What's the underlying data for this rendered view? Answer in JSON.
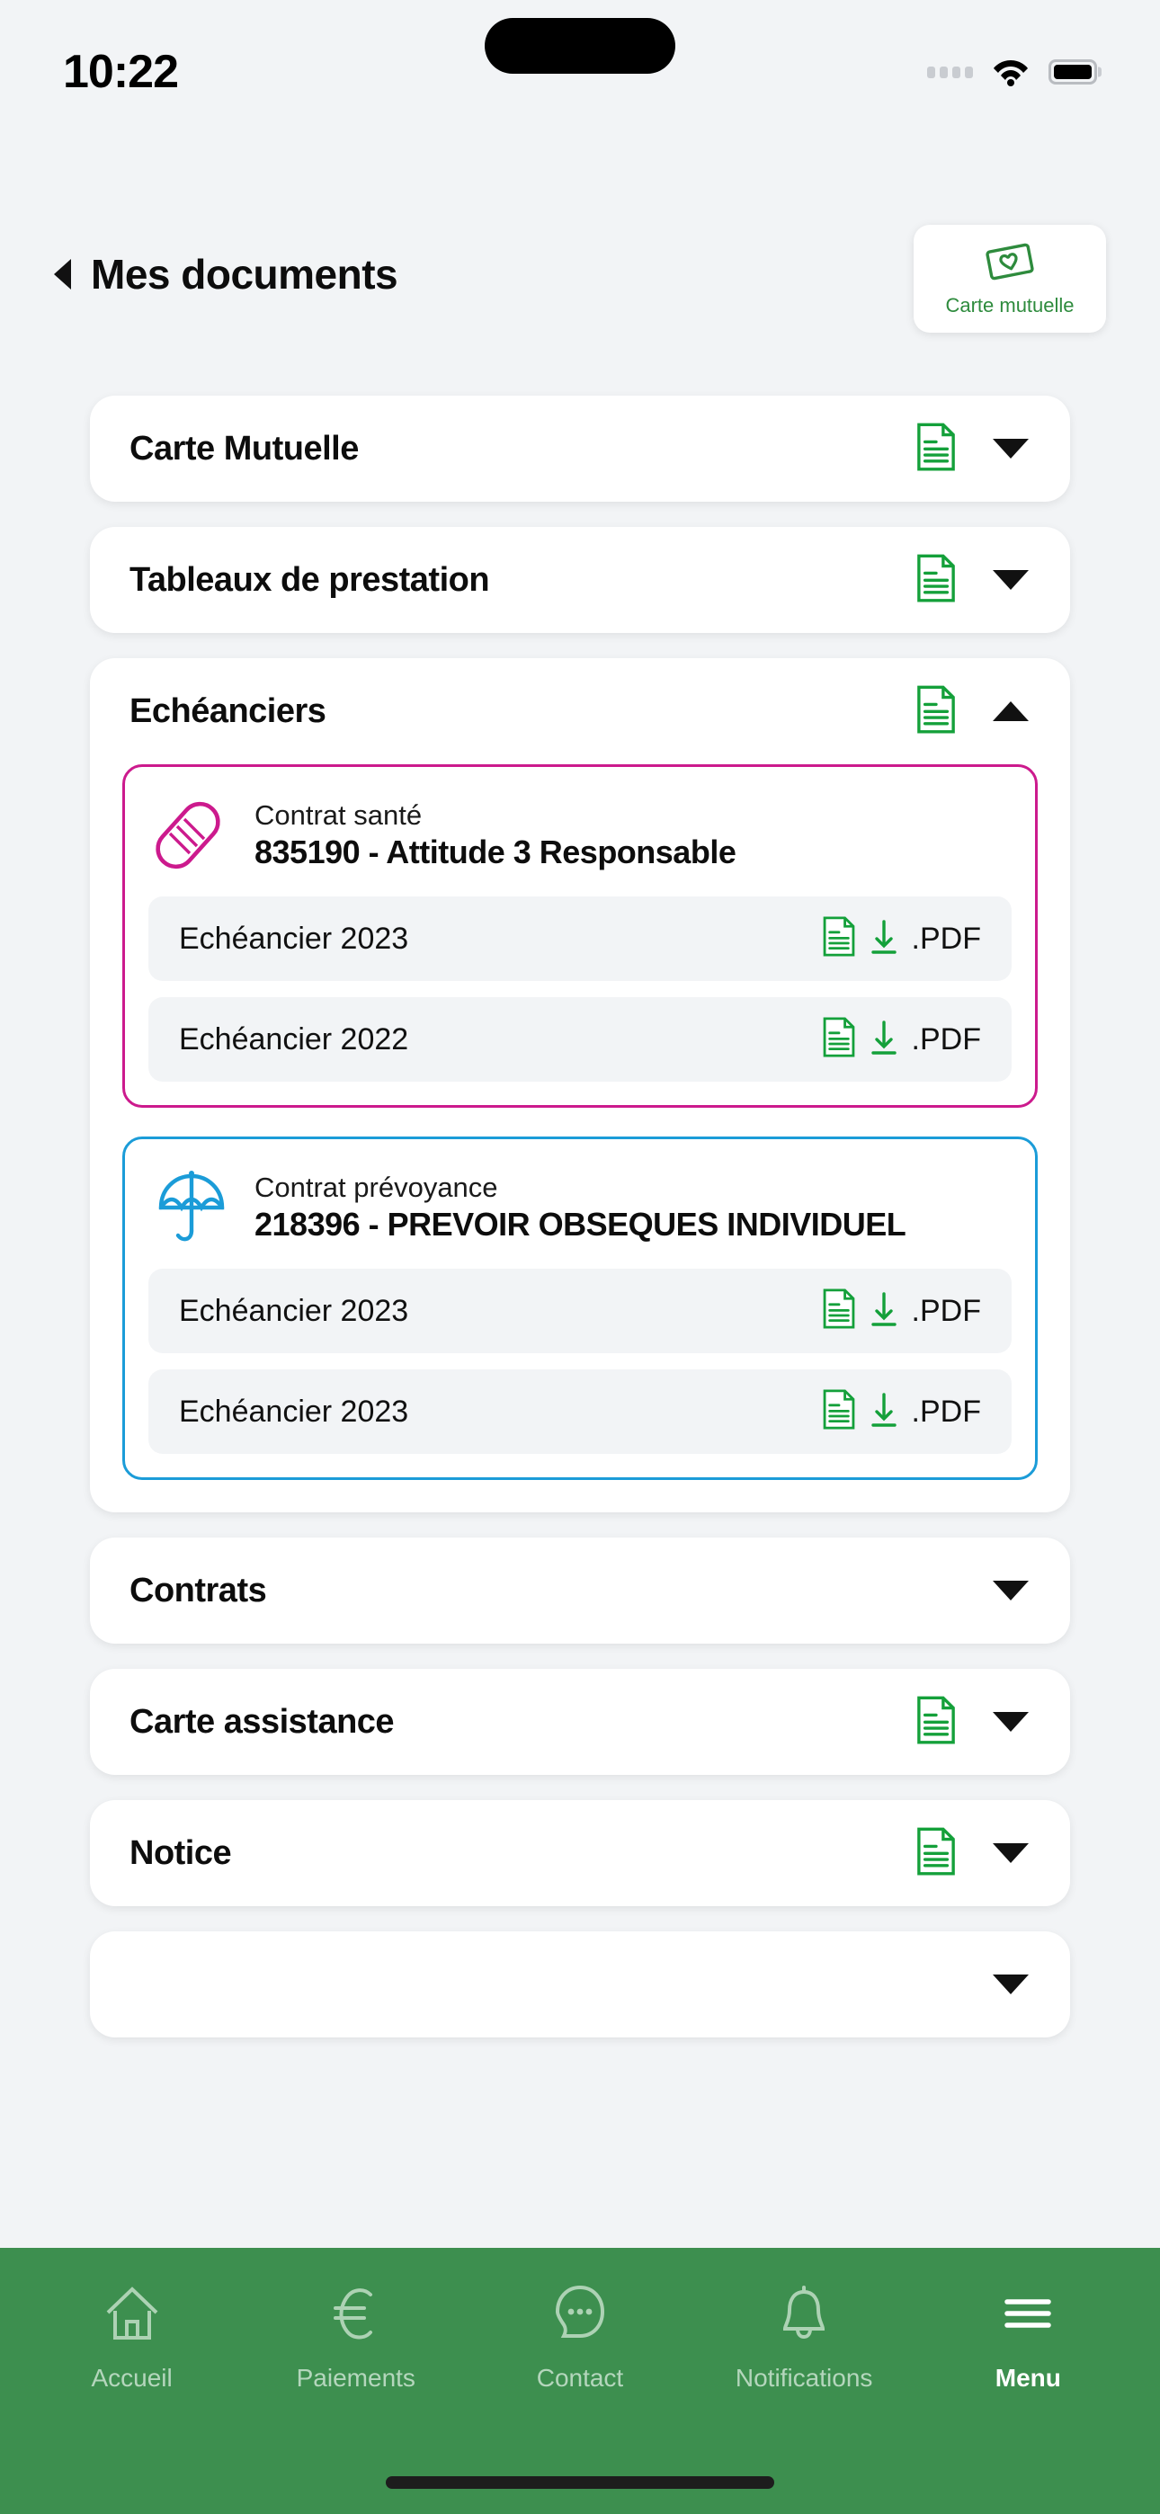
{
  "status_bar": {
    "time": "10:22",
    "signal_icon": "signal-dots-icon",
    "wifi_icon": "wifi-icon",
    "battery_icon": "battery-icon"
  },
  "header": {
    "back_icon": "back-arrow-icon",
    "title": "Mes documents",
    "action_button": {
      "icon": "mutual-card-heart-icon",
      "label": "Carte mutuelle"
    }
  },
  "colors": {
    "brand_green": "#3d8f4f",
    "doc_icon_green": "#14a03a",
    "health_magenta": "#cc1a8d",
    "prevoyance_blue": "#1b9cd8",
    "page_background": "#f2f4f6",
    "card_background": "#ffffff",
    "row_background": "#f2f4f6"
  },
  "sections": [
    {
      "title": "Carte Mutuelle",
      "has_doc_icon": true,
      "expanded": false,
      "chevron": "chevron-down-icon"
    },
    {
      "title": "Tableaux de prestation",
      "has_doc_icon": true,
      "expanded": false,
      "chevron": "chevron-down-icon"
    },
    {
      "title": "Echéanciers",
      "has_doc_icon": true,
      "expanded": true,
      "chevron": "chevron-up-icon",
      "contracts": [
        {
          "accent": "magenta",
          "icon": "bandage-icon",
          "kind": "Contrat santé",
          "name": "835190 - Attitude 3 Responsable",
          "documents": [
            {
              "label": "Echéancier 2023",
              "file_type": ".PDF",
              "doc_icon": "document-icon",
              "download_icon": "download-arrow-icon"
            },
            {
              "label": "Echéancier 2022",
              "file_type": ".PDF",
              "doc_icon": "document-icon",
              "download_icon": "download-arrow-icon"
            }
          ]
        },
        {
          "accent": "blue",
          "icon": "umbrella-icon",
          "kind": "Contrat prévoyance",
          "name": "218396 - PREVOIR OBSEQUES INDIVIDUEL",
          "documents": [
            {
              "label": "Echéancier 2023",
              "file_type": ".PDF",
              "doc_icon": "document-icon",
              "download_icon": "download-arrow-icon"
            },
            {
              "label": "Echéancier 2023",
              "file_type": ".PDF",
              "doc_icon": "document-icon",
              "download_icon": "download-arrow-icon"
            }
          ]
        }
      ]
    },
    {
      "title": "Contrats",
      "has_doc_icon": false,
      "expanded": false,
      "chevron": "chevron-down-icon"
    },
    {
      "title": "Carte assistance",
      "has_doc_icon": true,
      "expanded": false,
      "chevron": "chevron-down-icon"
    },
    {
      "title": "Notice",
      "has_doc_icon": true,
      "expanded": false,
      "chevron": "chevron-down-icon"
    },
    {
      "title": "",
      "has_doc_icon": false,
      "expanded": false,
      "chevron": "chevron-down-icon"
    }
  ],
  "bottom_nav": {
    "items": [
      {
        "label": "Accueil",
        "icon": "home-icon",
        "active": false
      },
      {
        "label": "Paiements",
        "icon": "euro-icon",
        "active": false
      },
      {
        "label": "Contact",
        "icon": "chat-bubble-icon",
        "active": false
      },
      {
        "label": "Notifications",
        "icon": "bell-icon",
        "active": false
      },
      {
        "label": "Menu",
        "icon": "hamburger-menu-icon",
        "active": true
      }
    ]
  }
}
